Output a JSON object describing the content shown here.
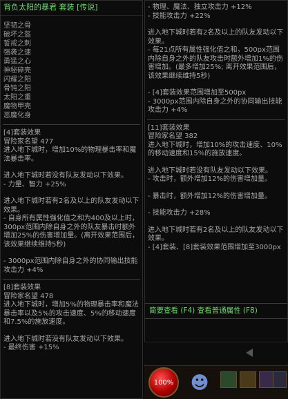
{
  "left": {
    "title": "背负太阳的暴君 套装 [传说]",
    "set_items": [
      "坚韧之骨",
      "破坏之盔",
      "誓戒之刺",
      "强袭之速",
      "勇猛之心",
      "神秘碎壳",
      "闪耀之阳",
      "骨钝之阳",
      "太阳之重",
      "魔物甲壳",
      "恶魔化身"
    ],
    "sections": [
      {
        "lines": [
          "[4]套装效果",
          "冒险家名望 477",
          "进入地下城时，增加10%的物理暴击率和魔法暴击率。",
          "",
          "进入地下城时若没有队友发动以下效果。",
          "- 力量、智力 +25%",
          "",
          "进入地下城时若有2名及以上的队友发动以下效果。",
          "- 自身所有属性强化值之和为400及以上时，300px范围内除自身之外的队友暴击时额外增加25%的伤害增加量。(离开效果范围后，该效果继续维持5秒)",
          "",
          "- 3000px范围内除自身之外的协同输出技能攻击力 +4%"
        ]
      },
      {
        "lines": [
          "[8]套装效果",
          "冒险家名望 478",
          "进入地下城时，增加5%的物理暴击率和魔法暴击率以及5%的攻击速度、5%的移动速度和7.5%的施放速度。",
          "",
          "进入地下城时若没有队友发动以下效果。",
          "- 最终伤害 +15%"
        ]
      }
    ]
  },
  "right": {
    "sections": [
      {
        "lines": [
          "- 物理、魔法、独立攻击力 +12%",
          "- 技能攻击力 +22%",
          "",
          "进入地下城时若有2名及以上的队友发动以下效果。",
          "- 每21点所有属性强化值之和，500px范围内除自身之外的队友攻击时额外增加1%的伤害增加。(最多增加25%; 离开效果范围后，该效果继续维持5秒)",
          "",
          "- [4]套装效果范围增加至500px",
          "- 3000px范围内除自身之外的协同输出技能攻击力 +4%"
        ]
      },
      {
        "lines": [
          "[11]套装效果",
          "冒险家名望 382",
          "进入地下城时，增加10%的攻击速度、10%的移动速度和15%的施放速度。",
          "",
          "进入地下城时若没有队友发动以下效果。",
          "- 攻击时，额外增加12%的伤害增加量。",
          "",
          "- 暴击时，额外增加12%的伤害增加量。",
          "",
          "- 技能攻击力 +28%",
          "",
          "进入地下城时若有2名及以上的队友发动以下效果。",
          "- [4]套装、[8]套装效果范围增加至3000px"
        ]
      }
    ],
    "footer": "简要查看 (F4) 查看普通属性 (F8)"
  },
  "hud": {
    "hp_percent_label": "100%"
  }
}
